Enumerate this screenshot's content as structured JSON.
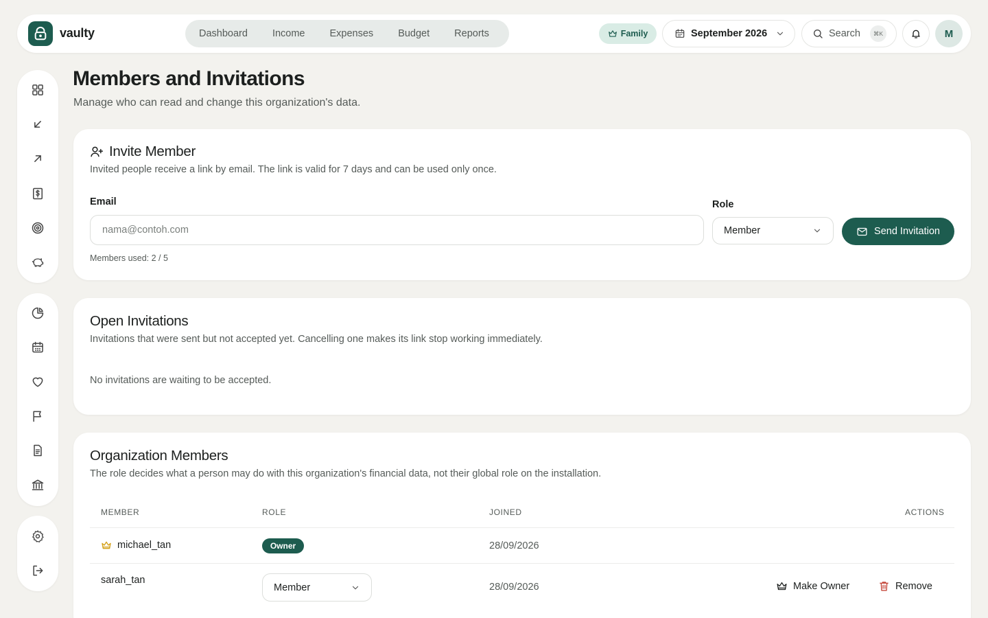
{
  "app": {
    "name": "vaulty"
  },
  "nav": {
    "items": [
      "Dashboard",
      "Income",
      "Expenses",
      "Budget",
      "Reports"
    ]
  },
  "header": {
    "plan_badge": "Family",
    "month": "September 2026",
    "search_label": "Search",
    "search_shortcut": "⌘K",
    "avatar_initial": "M"
  },
  "sidebar": {
    "group1": [
      "grid-icon",
      "arrow-down-left-icon",
      "arrow-up-right-icon",
      "receipt-dollar-icon",
      "target-icon",
      "piggy-bank-icon"
    ],
    "group2": [
      "pie-chart-icon",
      "calendar-icon",
      "heart-icon",
      "flag-icon",
      "document-icon",
      "bank-icon"
    ],
    "group3": [
      "settings-icon",
      "logout-icon"
    ]
  },
  "page": {
    "title": "Members and Invitations",
    "subtitle": "Manage who can read and change this organization's data."
  },
  "invite": {
    "title": "Invite Member",
    "description": "Invited people receive a link by email. The link is valid for 7 days and can be used only once.",
    "email_label": "Email",
    "email_placeholder": "nama@contoh.com",
    "role_label": "Role",
    "role_value": "Member",
    "send_button": "Send Invitation",
    "usage": "Members used: 2 / 5"
  },
  "open_invitations": {
    "title": "Open Invitations",
    "description": "Invitations that were sent but not accepted yet. Cancelling one makes its link stop working immediately.",
    "empty_text": "No invitations are waiting to be accepted."
  },
  "members": {
    "title": "Organization Members",
    "description": "The role decides what a person may do with this organization's financial data, not their global role on the installation.",
    "columns": [
      "MEMBER",
      "ROLE",
      "JOINED",
      "ACTIONS"
    ],
    "rows": [
      {
        "name": "michael_tan",
        "role": "Owner",
        "joined": "28/09/2026"
      },
      {
        "name": "sarah_tan",
        "role": "Member",
        "joined": "28/09/2026",
        "make_owner": "Make Owner",
        "remove": "Remove"
      }
    ]
  },
  "colors": {
    "accent": "#1d5c4f",
    "background": "#f3f2ee",
    "danger": "#c0392b",
    "crown": "#d4a017"
  }
}
